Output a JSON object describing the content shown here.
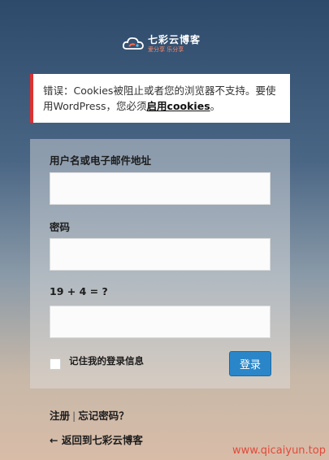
{
  "logo": {
    "title": "七彩云博客",
    "subtitle": "爱分享 乐分享"
  },
  "error": {
    "prefix": "错误：Cookies被阻止或者您的浏览器不支持。要使用WordPress，您必须",
    "link": "启用cookies",
    "suffix": "。"
  },
  "form": {
    "username_label": "用户名或电子邮件地址",
    "username_value": "",
    "password_label": "密码",
    "password_value": "",
    "captcha_label": "19 + 4 = ?",
    "captcha_value": "",
    "remember_label": "记住我的登录信息",
    "remember_checked": false,
    "submit_label": "登录"
  },
  "links": {
    "register": "注册",
    "separator": "|",
    "lost_password": "忘记密码？",
    "back": "← 返回到七彩云博客"
  },
  "watermark": "www.qicaiyun.top",
  "colors": {
    "error_border": "#dc3232",
    "button": "#2a86c8",
    "watermark": "#e24a3a"
  }
}
